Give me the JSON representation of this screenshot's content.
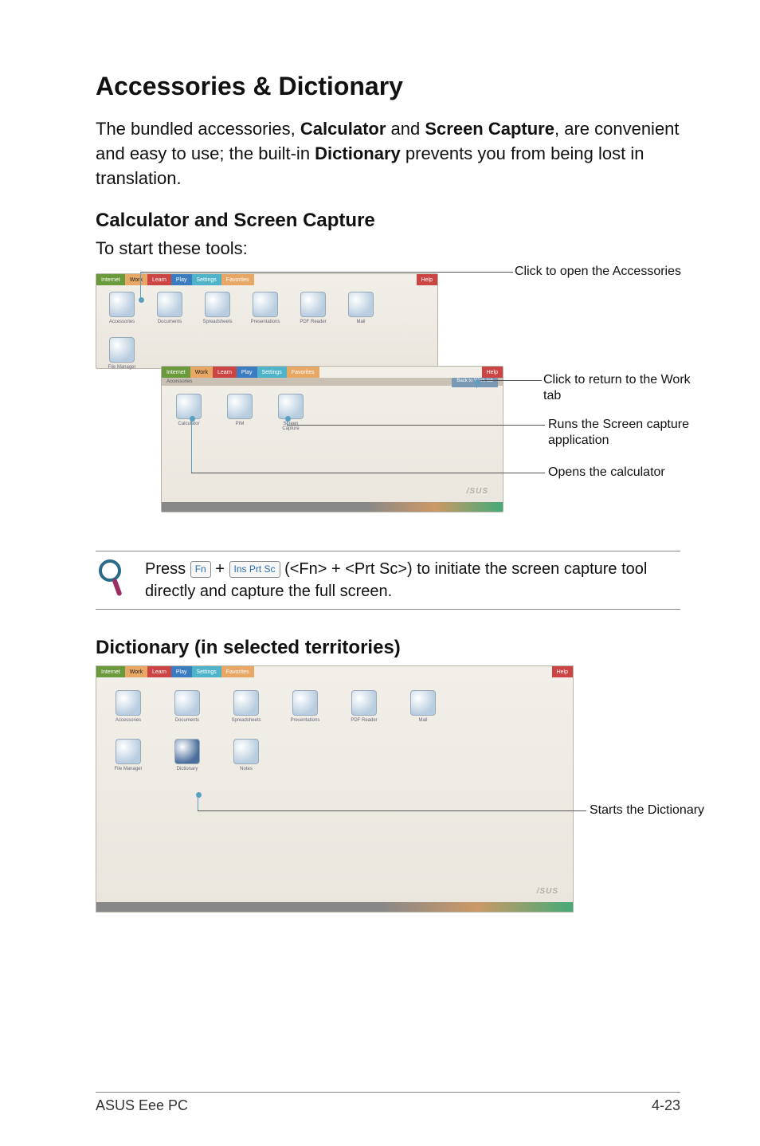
{
  "heading": "Accessories & Dictionary",
  "intro_parts": {
    "p1": "The bundled accessories, ",
    "b1": "Calculator",
    "p2": " and ",
    "b2": "Screen Capture",
    "p3": ", are convenient and easy to use; the built-in ",
    "b3": "Dictionary",
    "p4": " prevents you from being lost in translation."
  },
  "section1": {
    "title": "Calculator and Screen Capture",
    "lead": "To start these tools:",
    "callouts": {
      "open_acc": "Click to open the Accessories",
      "back_work": "Click to return to the Work tab",
      "run_capture": "Runs the Screen capture application",
      "open_calc": "Opens the calculator"
    },
    "shot_a": {
      "tabs": [
        "Internet",
        "Work",
        "Learn",
        "Play",
        "Settings",
        "Favorites"
      ],
      "help": "Help",
      "icons_row1": [
        "Accessories",
        "Documents",
        "Spreadsheets",
        "Presentations",
        "PDF Reader",
        "Mail"
      ],
      "icons_row2": [
        "File Manager"
      ]
    },
    "shot_b": {
      "tabs": [
        "Internet",
        "Work",
        "Learn",
        "Play",
        "Settings",
        "Favorites"
      ],
      "help": "Help",
      "subtitle": "Accessories",
      "back": "Back to Work tab",
      "icons": [
        "Calculator",
        "PIM",
        "Screen Capture"
      ]
    },
    "asus": "/SUS"
  },
  "tip": {
    "pre": "Press ",
    "key1": "Fn",
    "plus": " + ",
    "key2": "Ins\nPrt Sc",
    "paren": " (<Fn> + <Prt Sc>) to initiate the screen capture tool directly and capture the full screen."
  },
  "section2": {
    "title": "Dictionary (in selected territories)",
    "shot": {
      "tabs": [
        "Internet",
        "Work",
        "Learn",
        "Play",
        "Settings",
        "Favorites"
      ],
      "help": "Help",
      "icons_row1": [
        "Accessories",
        "Documents",
        "Spreadsheets",
        "Presentations",
        "PDF Reader",
        "Mail"
      ],
      "icons_row2": [
        "File Manager",
        "Dictionary",
        "Notes"
      ]
    },
    "callout": "Starts the Dictionary",
    "asus": "/SUS"
  },
  "footer": {
    "left": "ASUS Eee PC",
    "right": "4-23"
  }
}
